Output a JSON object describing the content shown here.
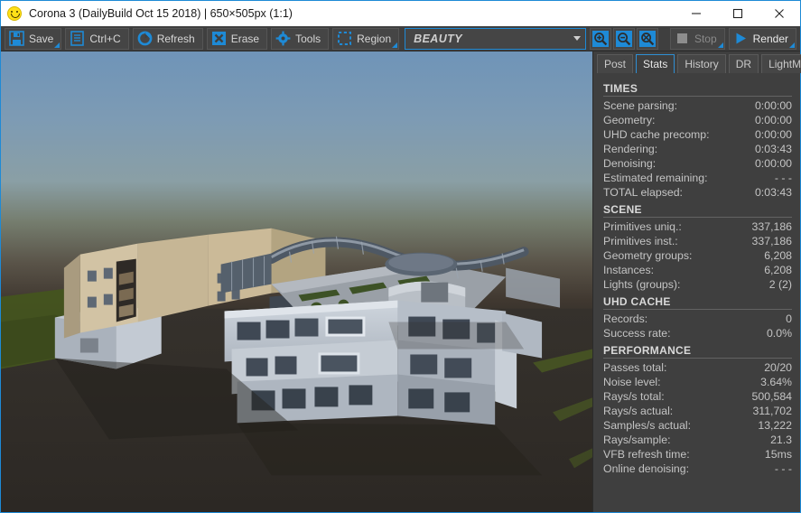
{
  "window": {
    "title": "Corona 3 (DailyBuild Oct 15 2018) | 650×505px (1:1)",
    "icon": "smiley-icon",
    "minimize_label": "—",
    "maximize_label": "□",
    "close_label": "×",
    "accent_color": "#1e8ad6"
  },
  "toolbar": {
    "save_label": "Save",
    "copy_label": "Ctrl+C",
    "refresh_label": "Refresh",
    "erase_label": "Erase",
    "tools_label": "Tools",
    "region_label": "Region",
    "render_element": "BEAUTY",
    "zoom_in_icon": "zoom-in-icon",
    "zoom_out_icon": "zoom-out-icon",
    "zoom_reset_icon": "zoom-reset-icon",
    "stop_label": "Stop",
    "render_label": "Render"
  },
  "panel": {
    "tabs": [
      {
        "label": "Post",
        "active": false
      },
      {
        "label": "Stats",
        "active": true
      },
      {
        "label": "History",
        "active": false
      },
      {
        "label": "DR",
        "active": false
      },
      {
        "label": "LightMix",
        "active": false
      }
    ],
    "sections": [
      {
        "title": "TIMES",
        "rows": [
          {
            "key": "Scene parsing:",
            "value": "0:00:00"
          },
          {
            "key": "Geometry:",
            "value": "0:00:00"
          },
          {
            "key": "UHD cache precomp:",
            "value": "0:00:00"
          },
          {
            "key": "Rendering:",
            "value": "0:03:43"
          },
          {
            "key": "Denoising:",
            "value": "0:00:00"
          },
          {
            "key": "Estimated remaining:",
            "value": "- - -"
          },
          {
            "key": "TOTAL elapsed:",
            "value": "0:03:43"
          }
        ]
      },
      {
        "title": "SCENE",
        "rows": [
          {
            "key": "Primitives uniq.:",
            "value": "337,186"
          },
          {
            "key": "Primitives inst.:",
            "value": "337,186"
          },
          {
            "key": "Geometry groups:",
            "value": "6,208"
          },
          {
            "key": "Instances:",
            "value": "6,208"
          },
          {
            "key": "Lights (groups):",
            "value": "2 (2)"
          }
        ]
      },
      {
        "title": "UHD CACHE",
        "rows": [
          {
            "key": "Records:",
            "value": "0"
          },
          {
            "key": "Success rate:",
            "value": "0.0%"
          }
        ]
      },
      {
        "title": "PERFORMANCE",
        "rows": [
          {
            "key": "Passes total:",
            "value": "20/20"
          },
          {
            "key": "Noise level:",
            "value": "3.64%"
          },
          {
            "key": "Rays/s total:",
            "value": "500,584"
          },
          {
            "key": "Rays/s actual:",
            "value": "311,702"
          },
          {
            "key": "Samples/s actual:",
            "value": "13,222"
          },
          {
            "key": "Rays/sample:",
            "value": "21.3"
          },
          {
            "key": "VFB refresh time:",
            "value": "15ms"
          },
          {
            "key": "Online denoising:",
            "value": "- - -"
          }
        ]
      }
    ]
  },
  "render": {
    "description": "3D architectural exterior render of a modern multi-building complex at dusk",
    "sky_top_color": "#6f94b8",
    "sky_horizon_color": "#6d7264",
    "ground_color": "#2f2b27",
    "grass_color": "#4a5c2a",
    "building_beige": "#c9b99a",
    "building_white": "#c6cdd6"
  }
}
